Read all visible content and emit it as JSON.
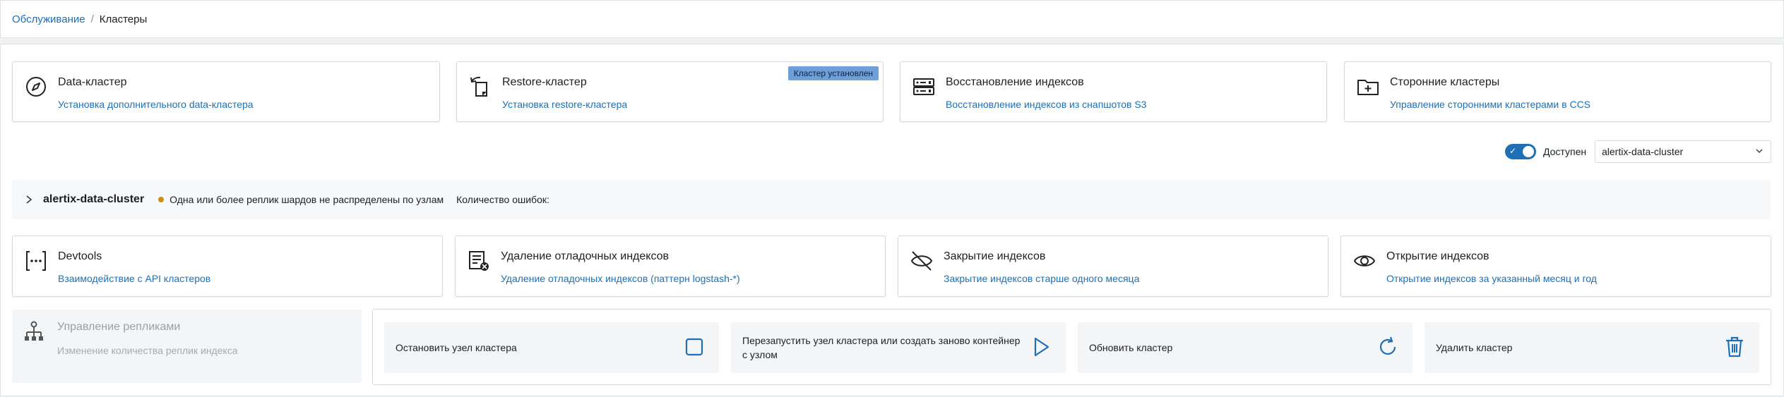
{
  "breadcrumb": {
    "parent": "Обслуживание",
    "separator": "/",
    "current": "Кластеры"
  },
  "top_cards": [
    {
      "title": "Data-кластер",
      "link": "Установка дополнительного data-кластера",
      "icon": "compass-icon"
    },
    {
      "title": "Restore-кластер",
      "link": "Установка restore-кластера",
      "icon": "restore-document-icon",
      "badge": "Кластер установлен"
    },
    {
      "title": "Восстановление индексов",
      "link": "Восстановление индексов из снапшотов S3",
      "icon": "server-restore-icon"
    },
    {
      "title": "Сторонние кластеры",
      "link": "Управление сторонними кластерами в CCS",
      "icon": "folder-plus-icon"
    }
  ],
  "availability": {
    "label": "Доступен",
    "enabled": true
  },
  "cluster_select": {
    "value": "alertix-data-cluster"
  },
  "cluster_bar": {
    "name": "alertix-data-cluster",
    "status": "Одна или более реплик шардов не распределены по узлам",
    "errors_label": "Количество ошибок:",
    "status_color": "#c8921a"
  },
  "tool_cards": [
    {
      "title": "Devtools",
      "link": "Взаимодействие с API кластеров",
      "icon": "devtools-icon"
    },
    {
      "title": "Удаление отладочных индексов",
      "link": "Удаление отладочных индексов (паттерн logstash-*)",
      "icon": "delete-index-icon"
    },
    {
      "title": "Закрытие индексов",
      "link": "Закрытие индексов старше одного месяца",
      "icon": "eye-off-icon"
    },
    {
      "title": "Открытие индексов",
      "link": "Открытие индексов за указанный месяц и год",
      "icon": "eye-icon"
    }
  ],
  "replicas": {
    "title": "Управление репликами",
    "subtitle": "Изменение количества реплик индекса",
    "icon": "hierarchy-icon"
  },
  "node_actions": [
    {
      "label": "Остановить узел кластера",
      "icon": "stop-icon"
    },
    {
      "label": "Перезапустить узел кластера или создать заново контейнер с узлом",
      "icon": "play-icon"
    },
    {
      "label": "Обновить кластер",
      "icon": "refresh-icon"
    },
    {
      "label": "Удалить кластер",
      "icon": "trash-icon"
    }
  ],
  "colors": {
    "link": "#1f6fb5",
    "badge": "#6f9fd8",
    "toggle": "#1f6fb5"
  }
}
